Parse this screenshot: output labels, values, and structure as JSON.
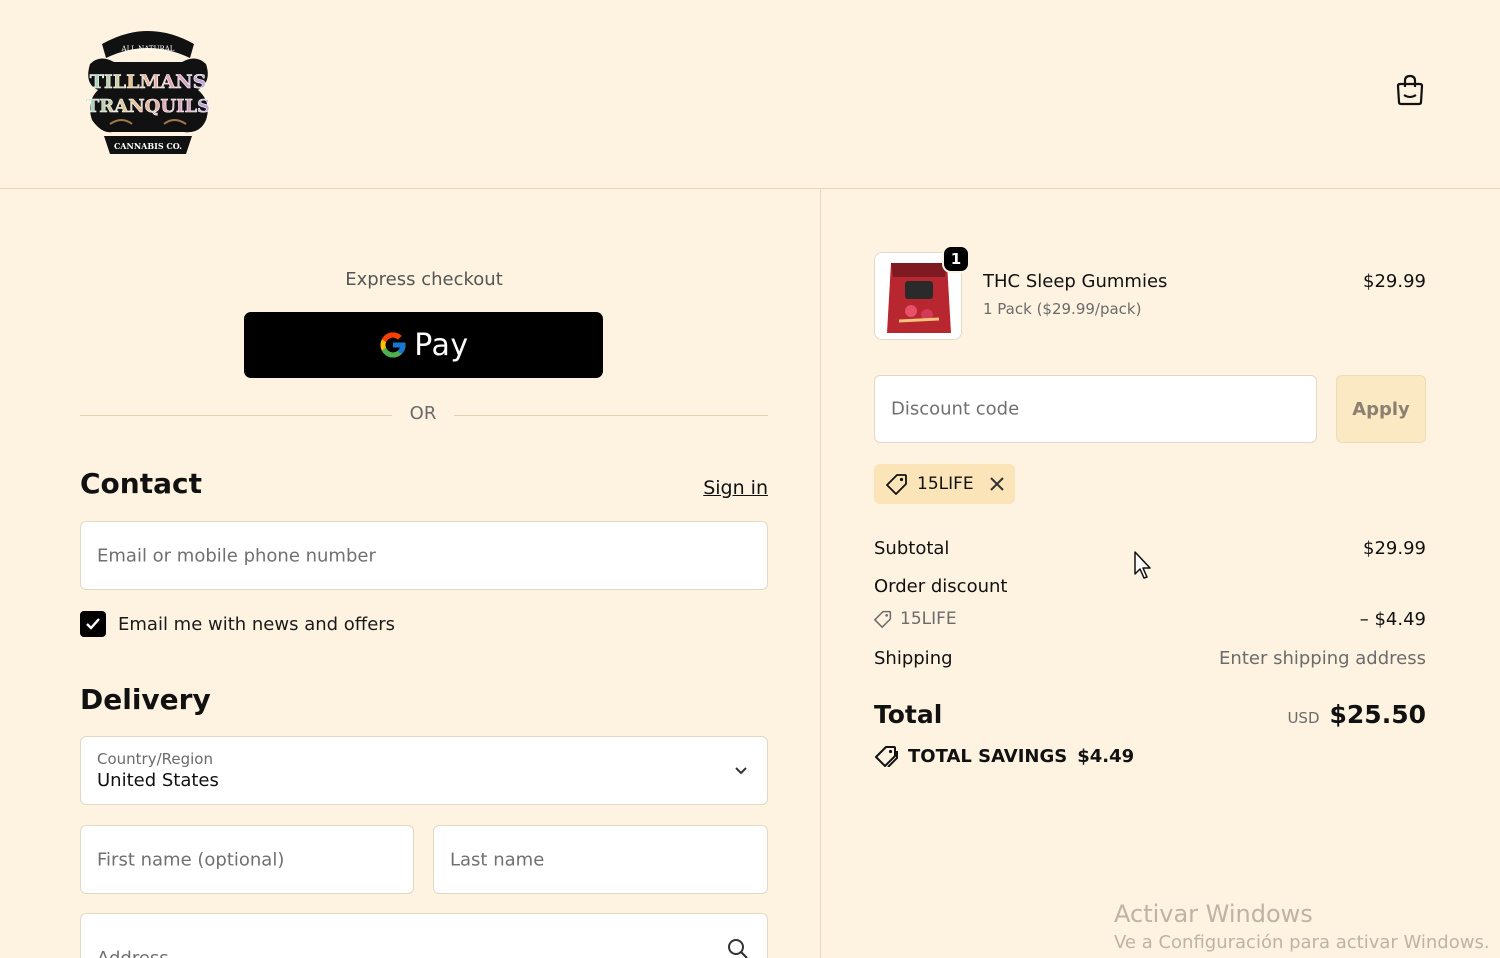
{
  "header": {
    "logo": {
      "top_text": "ALL NATURAL",
      "line1": "TILLMANS",
      "line2": "TRANQUILS",
      "bottom_text": "CANNABIS CO."
    },
    "cart_icon": "shopping-bag-icon"
  },
  "express": {
    "label": "Express checkout",
    "gpay_label": "Pay",
    "or_label": "OR"
  },
  "contact": {
    "title": "Contact",
    "signin_label": "Sign in",
    "email_placeholder": "Email or mobile phone number",
    "newsletter_label": "Email me with news and offers",
    "newsletter_checked": true
  },
  "delivery": {
    "title": "Delivery",
    "country_label": "Country/Region",
    "country_value": "United States",
    "first_name_placeholder": "First name (optional)",
    "last_name_placeholder": "Last name",
    "address_placeholder": "Address"
  },
  "order": {
    "item": {
      "name": "THC Sleep Gummies",
      "variant": "1 Pack ($29.99/pack)",
      "price": "$29.99",
      "quantity": "1"
    },
    "discount_placeholder": "Discount code",
    "apply_label": "Apply",
    "applied_code": "15LIFE",
    "subtotal_label": "Subtotal",
    "subtotal_value": "$29.99",
    "order_discount_label": "Order discount",
    "discount_code": "15LIFE",
    "discount_value": "– $4.49",
    "shipping_label": "Shipping",
    "shipping_value": "Enter shipping address",
    "total_label": "Total",
    "total_currency": "USD",
    "total_value": "$25.50",
    "savings_label": "TOTAL SAVINGS",
    "savings_value": "$4.49"
  },
  "watermark": {
    "line1": "Activar Windows",
    "line2": "Ve a Configuración para activar Windows."
  }
}
